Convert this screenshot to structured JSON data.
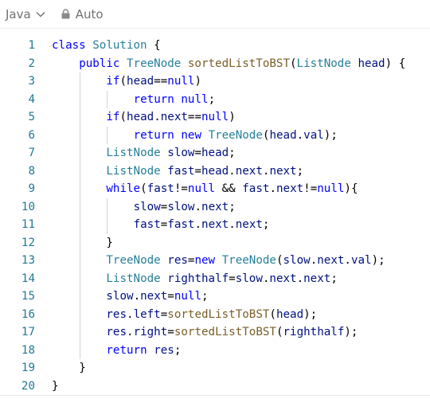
{
  "toolbar": {
    "language": "Java",
    "mode": "Auto",
    "language_icon": "chevron-down-icon",
    "mode_icon": "lock-icon"
  },
  "colors": {
    "keyword": "#0000ff",
    "type": "#267f99",
    "function": "#795e26",
    "variable": "#001080",
    "line_number": "#237893"
  },
  "editor": {
    "lines": [
      {
        "n": "1",
        "indent": 0,
        "tokens": [
          [
            "kw",
            "class"
          ],
          [
            "pl",
            " "
          ],
          [
            "ty",
            "Solution"
          ],
          [
            "pl",
            " {"
          ]
        ]
      },
      {
        "n": "2",
        "indent": 1,
        "tokens": [
          [
            "kw",
            "public"
          ],
          [
            "pl",
            " "
          ],
          [
            "ty",
            "TreeNode"
          ],
          [
            "pl",
            " "
          ],
          [
            "fn",
            "sortedListToBST"
          ],
          [
            "pl",
            "("
          ],
          [
            "ty",
            "ListNode"
          ],
          [
            "pl",
            " "
          ],
          [
            "vr",
            "head"
          ],
          [
            "pl",
            ") {"
          ]
        ]
      },
      {
        "n": "3",
        "indent": 2,
        "tokens": [
          [
            "kw",
            "if"
          ],
          [
            "pl",
            "("
          ],
          [
            "vr",
            "head"
          ],
          [
            "pl",
            "=="
          ],
          [
            "kw",
            "null"
          ],
          [
            "pl",
            ")"
          ]
        ]
      },
      {
        "n": "4",
        "indent": 3,
        "tokens": [
          [
            "kw",
            "return"
          ],
          [
            "pl",
            " "
          ],
          [
            "kw",
            "null"
          ],
          [
            "pl",
            ";"
          ]
        ]
      },
      {
        "n": "5",
        "indent": 2,
        "tokens": [
          [
            "kw",
            "if"
          ],
          [
            "pl",
            "("
          ],
          [
            "vr",
            "head"
          ],
          [
            "pl",
            "."
          ],
          [
            "vr",
            "next"
          ],
          [
            "pl",
            "=="
          ],
          [
            "kw",
            "null"
          ],
          [
            "pl",
            ")"
          ]
        ]
      },
      {
        "n": "6",
        "indent": 3,
        "tokens": [
          [
            "kw",
            "return"
          ],
          [
            "pl",
            " "
          ],
          [
            "kw",
            "new"
          ],
          [
            "pl",
            " "
          ],
          [
            "ty",
            "TreeNode"
          ],
          [
            "pl",
            "("
          ],
          [
            "vr",
            "head"
          ],
          [
            "pl",
            "."
          ],
          [
            "vr",
            "val"
          ],
          [
            "pl",
            ");"
          ]
        ]
      },
      {
        "n": "7",
        "indent": 2,
        "tokens": [
          [
            "ty",
            "ListNode"
          ],
          [
            "pl",
            " "
          ],
          [
            "vr",
            "slow"
          ],
          [
            "pl",
            "="
          ],
          [
            "vr",
            "head"
          ],
          [
            "pl",
            ";"
          ]
        ]
      },
      {
        "n": "8",
        "indent": 2,
        "tokens": [
          [
            "ty",
            "ListNode"
          ],
          [
            "pl",
            " "
          ],
          [
            "vr",
            "fast"
          ],
          [
            "pl",
            "="
          ],
          [
            "vr",
            "head"
          ],
          [
            "pl",
            "."
          ],
          [
            "vr",
            "next"
          ],
          [
            "pl",
            "."
          ],
          [
            "vr",
            "next"
          ],
          [
            "pl",
            ";"
          ]
        ]
      },
      {
        "n": "9",
        "indent": 2,
        "tokens": [
          [
            "kw",
            "while"
          ],
          [
            "pl",
            "("
          ],
          [
            "vr",
            "fast"
          ],
          [
            "pl",
            "!="
          ],
          [
            "kw",
            "null"
          ],
          [
            "pl",
            " && "
          ],
          [
            "vr",
            "fast"
          ],
          [
            "pl",
            "."
          ],
          [
            "vr",
            "next"
          ],
          [
            "pl",
            "!="
          ],
          [
            "kw",
            "null"
          ],
          [
            "pl",
            "){"
          ]
        ]
      },
      {
        "n": "10",
        "indent": 3,
        "tokens": [
          [
            "vr",
            "slow"
          ],
          [
            "pl",
            "="
          ],
          [
            "vr",
            "slow"
          ],
          [
            "pl",
            "."
          ],
          [
            "vr",
            "next"
          ],
          [
            "pl",
            ";"
          ]
        ]
      },
      {
        "n": "11",
        "indent": 3,
        "tokens": [
          [
            "vr",
            "fast"
          ],
          [
            "pl",
            "="
          ],
          [
            "vr",
            "fast"
          ],
          [
            "pl",
            "."
          ],
          [
            "vr",
            "next"
          ],
          [
            "pl",
            "."
          ],
          [
            "vr",
            "next"
          ],
          [
            "pl",
            ";"
          ]
        ]
      },
      {
        "n": "12",
        "indent": 2,
        "tokens": [
          [
            "pl",
            "}"
          ]
        ]
      },
      {
        "n": "13",
        "indent": 2,
        "tokens": [
          [
            "ty",
            "TreeNode"
          ],
          [
            "pl",
            " "
          ],
          [
            "vr",
            "res"
          ],
          [
            "pl",
            "="
          ],
          [
            "kw",
            "new"
          ],
          [
            "pl",
            " "
          ],
          [
            "ty",
            "TreeNode"
          ],
          [
            "pl",
            "("
          ],
          [
            "vr",
            "slow"
          ],
          [
            "pl",
            "."
          ],
          [
            "vr",
            "next"
          ],
          [
            "pl",
            "."
          ],
          [
            "vr",
            "val"
          ],
          [
            "pl",
            ");"
          ]
        ]
      },
      {
        "n": "14",
        "indent": 2,
        "tokens": [
          [
            "ty",
            "ListNode"
          ],
          [
            "pl",
            " "
          ],
          [
            "vr",
            "righthalf"
          ],
          [
            "pl",
            "="
          ],
          [
            "vr",
            "slow"
          ],
          [
            "pl",
            "."
          ],
          [
            "vr",
            "next"
          ],
          [
            "pl",
            "."
          ],
          [
            "vr",
            "next"
          ],
          [
            "pl",
            ";"
          ]
        ]
      },
      {
        "n": "15",
        "indent": 2,
        "tokens": [
          [
            "vr",
            "slow"
          ],
          [
            "pl",
            "."
          ],
          [
            "vr",
            "next"
          ],
          [
            "pl",
            "="
          ],
          [
            "kw",
            "null"
          ],
          [
            "pl",
            ";"
          ]
        ]
      },
      {
        "n": "16",
        "indent": 2,
        "tokens": [
          [
            "vr",
            "res"
          ],
          [
            "pl",
            "."
          ],
          [
            "vr",
            "left"
          ],
          [
            "pl",
            "="
          ],
          [
            "fn",
            "sortedListToBST"
          ],
          [
            "pl",
            "("
          ],
          [
            "vr",
            "head"
          ],
          [
            "pl",
            ");"
          ]
        ]
      },
      {
        "n": "17",
        "indent": 2,
        "tokens": [
          [
            "vr",
            "res"
          ],
          [
            "pl",
            "."
          ],
          [
            "vr",
            "right"
          ],
          [
            "pl",
            "="
          ],
          [
            "fn",
            "sortedListToBST"
          ],
          [
            "pl",
            "("
          ],
          [
            "vr",
            "righthalf"
          ],
          [
            "pl",
            ");"
          ]
        ]
      },
      {
        "n": "18",
        "indent": 2,
        "tokens": [
          [
            "kw",
            "return"
          ],
          [
            "pl",
            " "
          ],
          [
            "vr",
            "res"
          ],
          [
            "pl",
            ";"
          ]
        ]
      },
      {
        "n": "19",
        "indent": 1,
        "tokens": [
          [
            "pl",
            "}"
          ]
        ]
      },
      {
        "n": "20",
        "indent": 0,
        "tokens": [
          [
            "pl",
            "}"
          ]
        ]
      }
    ]
  }
}
